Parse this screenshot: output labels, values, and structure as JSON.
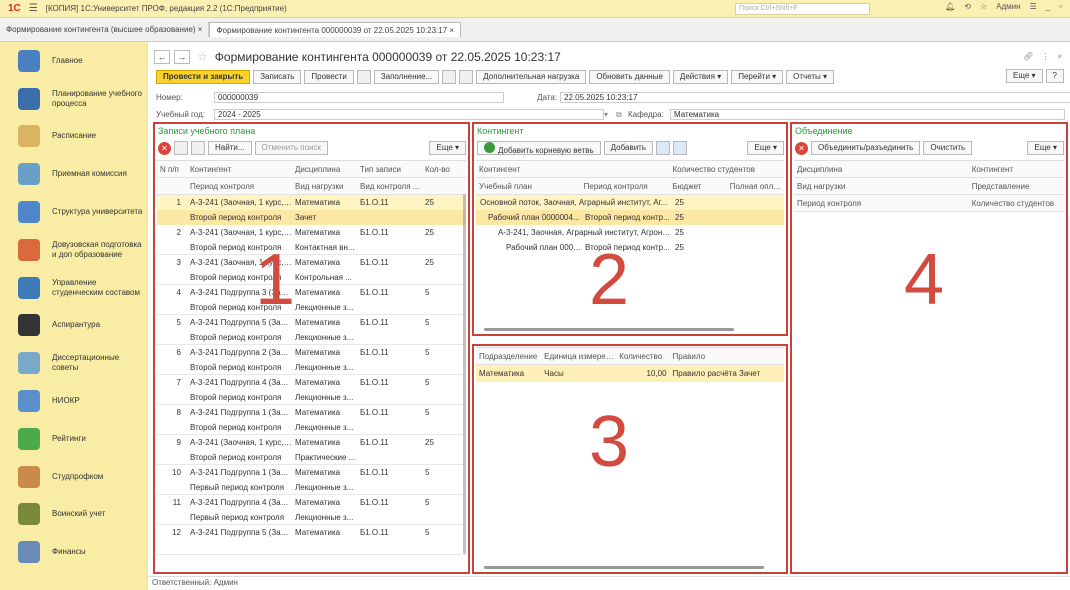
{
  "window": {
    "logo": "1С",
    "title": "[КОПИЯ] 1С:Университет ПРОФ, редакция 2.2  (1С:Предприятие)",
    "search_placeholder": "Поиск Ctrl+Shift+F",
    "user": "Админ"
  },
  "tabs": [
    {
      "label": "Формирование контингента (высшее образование) ×"
    },
    {
      "label": "Формирование контингента 000000039 от 22.05.2025 10:23:17 ×"
    }
  ],
  "sidebar": {
    "items": [
      {
        "label": "Главное",
        "color": "#4a7fc1"
      },
      {
        "label": "Планирование учебного процесса",
        "color": "#3a6ea8"
      },
      {
        "label": "Расписание",
        "color": "#d8b463"
      },
      {
        "label": "Приемная комиссия",
        "color": "#6aa0c8"
      },
      {
        "label": "Структура университета",
        "color": "#4f86c9"
      },
      {
        "label": "Довузовская подготовка и доп образование",
        "color": "#d86a3c"
      },
      {
        "label": "Управление студенческим составом",
        "color": "#3c7ab8"
      },
      {
        "label": "Аспирантура",
        "color": "#333333"
      },
      {
        "label": "Диссертационные советы",
        "color": "#7aa8c8"
      },
      {
        "label": "НИОКР",
        "color": "#5a8fc8"
      },
      {
        "label": "Рейтинги",
        "color": "#4caa4c"
      },
      {
        "label": "Студпрофком",
        "color": "#c98a4a"
      },
      {
        "label": "Воинский учет",
        "color": "#7a8a3c"
      },
      {
        "label": "Финансы",
        "color": "#6a8ab8"
      }
    ]
  },
  "doc": {
    "title": "Формирование контингента 000000039 от 22.05.2025 10:23:17",
    "toolbar": {
      "post_close": "Провести и закрыть",
      "save": "Записать",
      "post": "Провести",
      "fill": "Заполнение...",
      "extra_load": "Дополнительная нагрузка",
      "refresh": "Обновить данные",
      "actions": "Действия ▾",
      "goto": "Перейти ▾",
      "reports": "Отчеты ▾",
      "more": "Еще ▾",
      "help": "?"
    },
    "fields": {
      "number_label": "Номер:",
      "number": "000000039",
      "date_label": "Дата:",
      "date": "22.05.2025 10:23:17",
      "year_label": "Учебный год:",
      "year": "2024 - 2025",
      "dept_label": "Кафедра:",
      "dept": "Математика"
    },
    "footer": "Ответственный:  Админ"
  },
  "panel1": {
    "title": "Записи учебного плана",
    "find": "Найти...",
    "cancel_find": "Отменить поиск",
    "more": "Еще ▾",
    "headers1": [
      "N п/п",
      "Контингент",
      "Дисциплина",
      "Тип записи",
      "Кол-во"
    ],
    "headers2": [
      "Период контроля",
      "Вид нагрузки",
      "Вид контроля ..."
    ],
    "rows": [
      {
        "n": "1",
        "k": "А-3-241 (Заочная, 1 курс, ...",
        "d": "Математика",
        "t": "Б1.О.11",
        "q": "25",
        "p": "Второй период контроля",
        "v": "Зачет"
      },
      {
        "n": "2",
        "k": "А-3-241 (Заочная, 1 курс, ...",
        "d": "Математика",
        "t": "Б1.О.11",
        "q": "25",
        "p": "Второй период контроля",
        "v": "Контактная вн..."
      },
      {
        "n": "3",
        "k": "А-3-241 (Заочная, 1 курс, ...",
        "d": "Математика",
        "t": "Б1.О.11",
        "q": "25",
        "p": "Второй период контроля",
        "v": "Контрольная ..."
      },
      {
        "n": "4",
        "k": "А-3-241 Подгруппа 3 (Заоч...",
        "d": "Математика",
        "t": "Б1.О.11",
        "q": "5",
        "p": "Второй период контроля",
        "v": "Лекционные з..."
      },
      {
        "n": "5",
        "k": "А-3-241 Подгруппа 5 (Заоч...",
        "d": "Математика",
        "t": "Б1.О.11",
        "q": "5",
        "p": "Второй период контроля",
        "v": "Лекционные з..."
      },
      {
        "n": "6",
        "k": "А-3-241 Подгруппа 2 (Заоч...",
        "d": "Математика",
        "t": "Б1.О.11",
        "q": "5",
        "p": "Второй период контроля",
        "v": "Лекционные з..."
      },
      {
        "n": "7",
        "k": "А-3-241 Подгруппа 4 (Заоч...",
        "d": "Математика",
        "t": "Б1.О.11",
        "q": "5",
        "p": "Второй период контроля",
        "v": "Лекционные з..."
      },
      {
        "n": "8",
        "k": "А-3-241 Подгруппа 1 (Заоч...",
        "d": "Математика",
        "t": "Б1.О.11",
        "q": "5",
        "p": "Второй период контроля",
        "v": "Лекционные з..."
      },
      {
        "n": "9",
        "k": "А-3-241 (Заочная, 1 курс, ...",
        "d": "Математика",
        "t": "Б1.О.11",
        "q": "25",
        "p": "Второй период контроля",
        "v": "Практические ..."
      },
      {
        "n": "10",
        "k": "А-3-241 Подгруппа 1 (Заоч...",
        "d": "Математика",
        "t": "Б1.О.11",
        "q": "5",
        "p": "Первый период контроля",
        "v": "Лекционные з..."
      },
      {
        "n": "11",
        "k": "А-3-241 Подгруппа 4 (Заоч...",
        "d": "Математика",
        "t": "Б1.О.11",
        "q": "5",
        "p": "Первый период контроля",
        "v": "Лекционные з..."
      },
      {
        "n": "12",
        "k": "А-3-241 Подгруппа 5 (Заоч...",
        "d": "Математика",
        "t": "Б1.О.11",
        "q": "5",
        "p": "",
        "v": ""
      }
    ]
  },
  "panel2": {
    "title": "Контингент",
    "add_root": "Добавить корневую ветвь",
    "add": "Добавить",
    "more": "Еще ▾",
    "headers1": [
      "Контингент",
      "Количество студентов"
    ],
    "headers2": [
      "Учебный план",
      "Период контроля",
      "Бюджет",
      "Полная оплата"
    ],
    "rows": [
      {
        "a": "Основной поток, Заочная, Аграрный институт, Аг...",
        "b": "",
        "c": "25"
      },
      {
        "a": "Рабочий план 0000004...",
        "b": "Второй период контр...",
        "c": "25"
      },
      {
        "a": "А-3-241, Заочная, Аграрный институт, Агроно...",
        "b": "",
        "c": "25"
      },
      {
        "a": "Рабочий план 0000...",
        "b": "Второй период контр...",
        "c": "25"
      }
    ]
  },
  "panel3": {
    "headers": [
      "Подразделение",
      "Единица измерения",
      "Количество",
      "Правило"
    ],
    "rows": [
      {
        "a": "Математика",
        "b": "Часы",
        "c": "10,00",
        "d": "Правило расчёта Зачет"
      }
    ]
  },
  "panel4": {
    "title": "Объединение",
    "merge": "Объединить/разъединить",
    "clear": "Очистить",
    "more": "Еще ▾",
    "headers": [
      [
        "Дисциплина",
        "Контингент"
      ],
      [
        "Вид нагрузки",
        "Представление"
      ],
      [
        "Период контроля",
        "Количество студентов"
      ]
    ]
  },
  "annotations": [
    "1",
    "2",
    "3",
    "4"
  ]
}
